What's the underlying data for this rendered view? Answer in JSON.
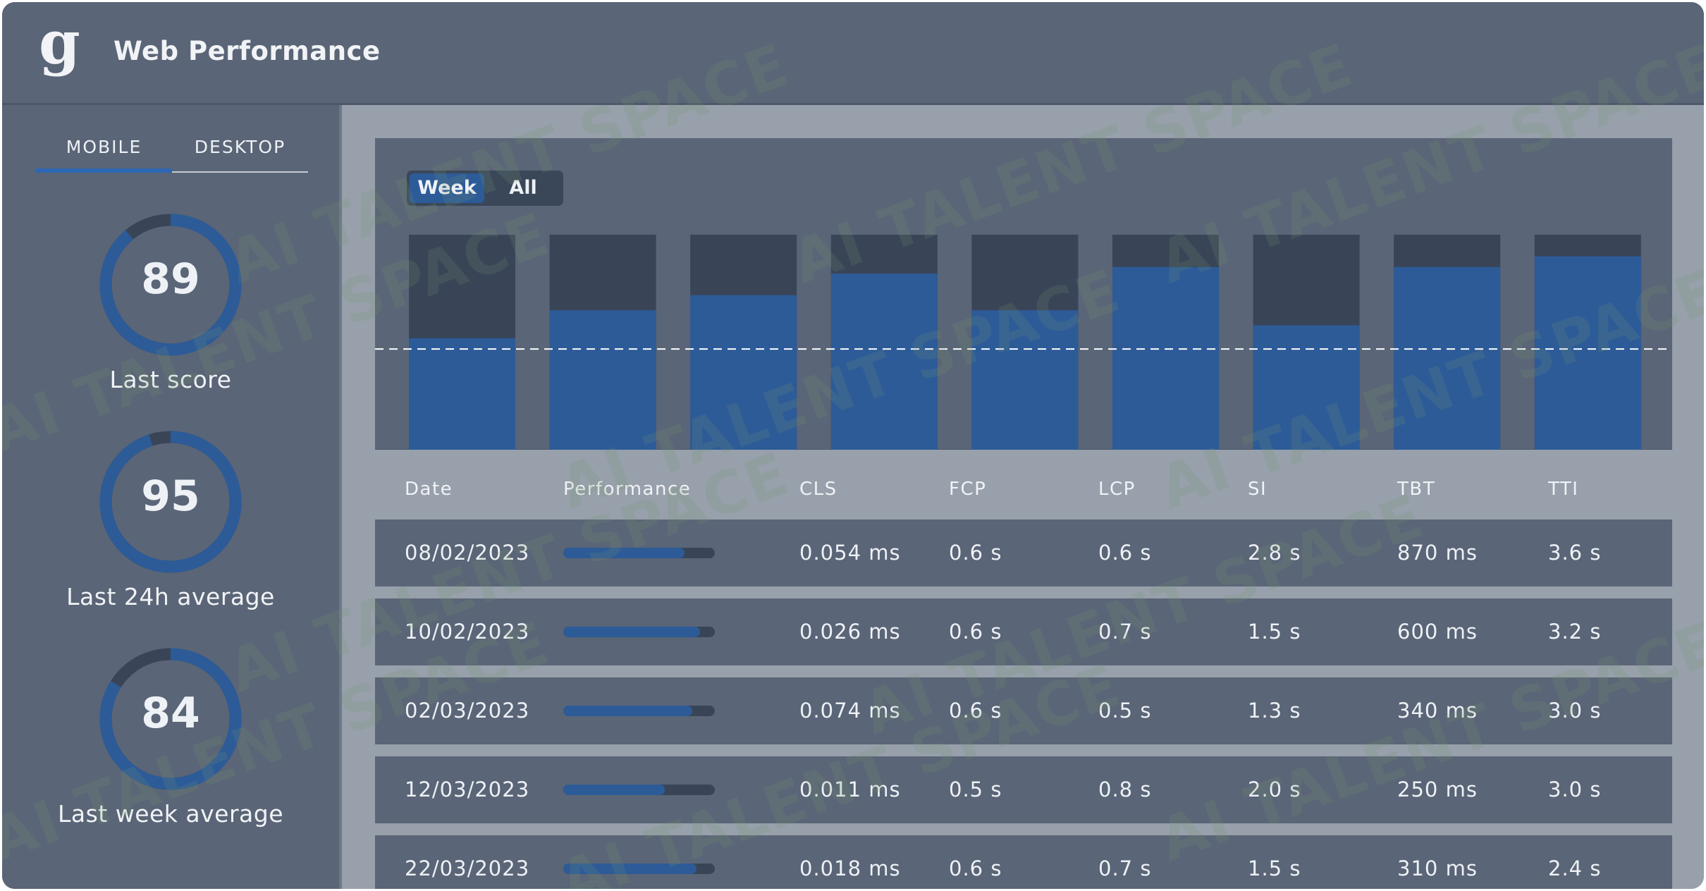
{
  "header": {
    "logo": "g",
    "title": "Web Performance"
  },
  "sidebar": {
    "tabs": [
      {
        "label": "MOBILE",
        "active": true
      },
      {
        "label": "DESKTOP",
        "active": false
      }
    ],
    "gauges": [
      {
        "value": "89",
        "label": "Last score",
        "fraction": 0.89
      },
      {
        "value": "95",
        "label": "Last 24h average",
        "fraction": 0.95
      },
      {
        "value": "84",
        "label": "Last week average",
        "fraction": 0.84
      }
    ]
  },
  "chart": {
    "range_options": [
      "Week",
      "All"
    ],
    "selected_range": "Week"
  },
  "chart_data": {
    "type": "bar",
    "categories": [
      "",
      "",
      "",
      "",
      "",
      "",
      "",
      "",
      "",
      ""
    ],
    "values": [
      52,
      65,
      72,
      82,
      65,
      85,
      58,
      85,
      90,
      0
    ],
    "ylim": [
      0,
      100
    ],
    "reference_line": 47,
    "colors": {
      "bar": "#2c5b98",
      "track": "#394557",
      "line": "#ffffff"
    }
  },
  "table": {
    "columns": [
      "Date",
      "Performance",
      "CLS",
      "FCP",
      "LCP",
      "SI",
      "TBT",
      "TTI"
    ],
    "rows": [
      {
        "date": "08/02/2023",
        "performance": 0.8,
        "cls": "0.054 ms",
        "fcp": "0.6 s",
        "lcp": "0.6 s",
        "si": "2.8 s",
        "tbt": "870 ms",
        "tti": "3.6 s"
      },
      {
        "date": "10/02/2023",
        "performance": 0.9,
        "cls": "0.026 ms",
        "fcp": "0.6 s",
        "lcp": "0.7 s",
        "si": "1.5 s",
        "tbt": "600 ms",
        "tti": "3.2 s"
      },
      {
        "date": "02/03/2023",
        "performance": 0.85,
        "cls": "0.074 ms",
        "fcp": "0.6 s",
        "lcp": "0.5 s",
        "si": "1.3 s",
        "tbt": "340 ms",
        "tti": "3.0 s"
      },
      {
        "date": "12/03/2023",
        "performance": 0.67,
        "cls": "0.011 ms",
        "fcp": "0.5 s",
        "lcp": "0.8 s",
        "si": "2.0 s",
        "tbt": "250 ms",
        "tti": "3.0 s"
      },
      {
        "date": "22/03/2023",
        "performance": 0.88,
        "cls": "0.018 ms",
        "fcp": "0.6 s",
        "lcp": "0.7 s",
        "si": "1.5 s",
        "tbt": "310 ms",
        "tti": "2.4 s"
      }
    ]
  },
  "watermark": "AI TALENT SPACE",
  "colors": {
    "background": "#5a6577",
    "panel": "#97a0ab",
    "accent": "#2c5b98",
    "track": "#394557"
  }
}
